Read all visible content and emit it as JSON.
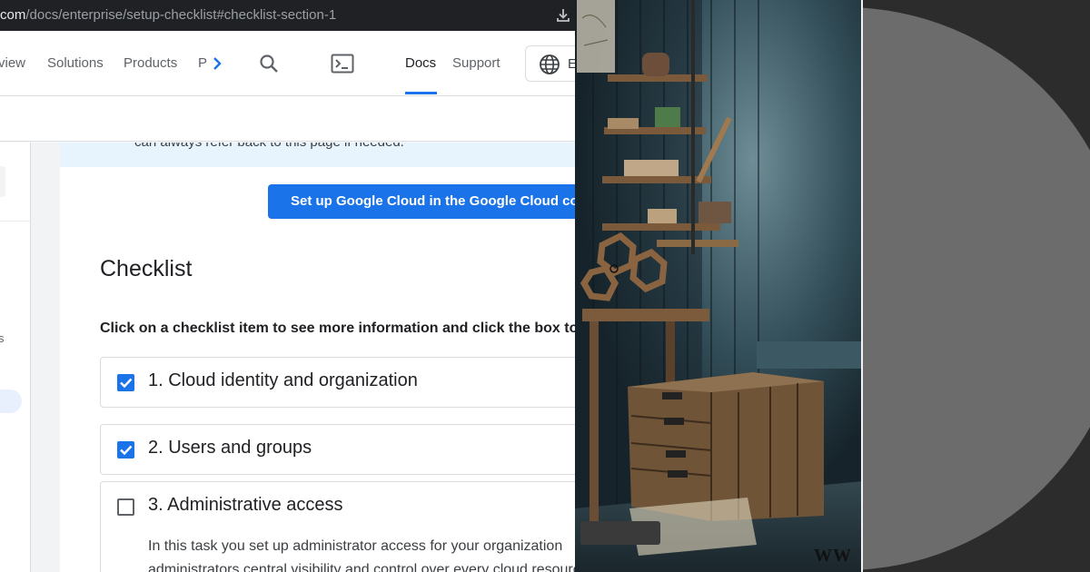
{
  "browser": {
    "url_domain_part": "com",
    "url_path": "/docs/enterprise/setup-checklist#checklist-section-1"
  },
  "nav": {
    "items": [
      "view",
      "Solutions",
      "Products",
      "P",
      "Docs",
      "Support"
    ],
    "active": "Docs",
    "language_label": "E"
  },
  "sidebar": {
    "partial_label": "s"
  },
  "callout": {
    "text": "can always refer back to this page if needed."
  },
  "cta": {
    "label": "Set up Google Cloud in the Google Cloud console"
  },
  "checklist": {
    "title": "Checklist",
    "instructions": "Click on a checklist item to see more information and click the box to",
    "items": [
      {
        "label": "1. Cloud identity and organization",
        "checked": true
      },
      {
        "label": "2. Users and groups",
        "checked": true
      },
      {
        "label": "3. Administrative access",
        "checked": false,
        "description_lines": [
          "In this task you set up administrator access for your organization",
          "administrators central visibility and control over every cloud resource"
        ]
      }
    ]
  },
  "illustration": {
    "watermark": "WW"
  },
  "colors": {
    "accent": "#1a73e8",
    "callout_bg": "#e8f4fd",
    "url_bar": "#202124",
    "illustration_bg": "#1d2a31",
    "right_bg": "#2c2c2c",
    "disc": "#6c6c6c"
  },
  "icons": [
    "download-icon",
    "chevron-right-icon",
    "search-icon",
    "terminal-icon",
    "globe-icon",
    "checkbox-icon"
  ]
}
